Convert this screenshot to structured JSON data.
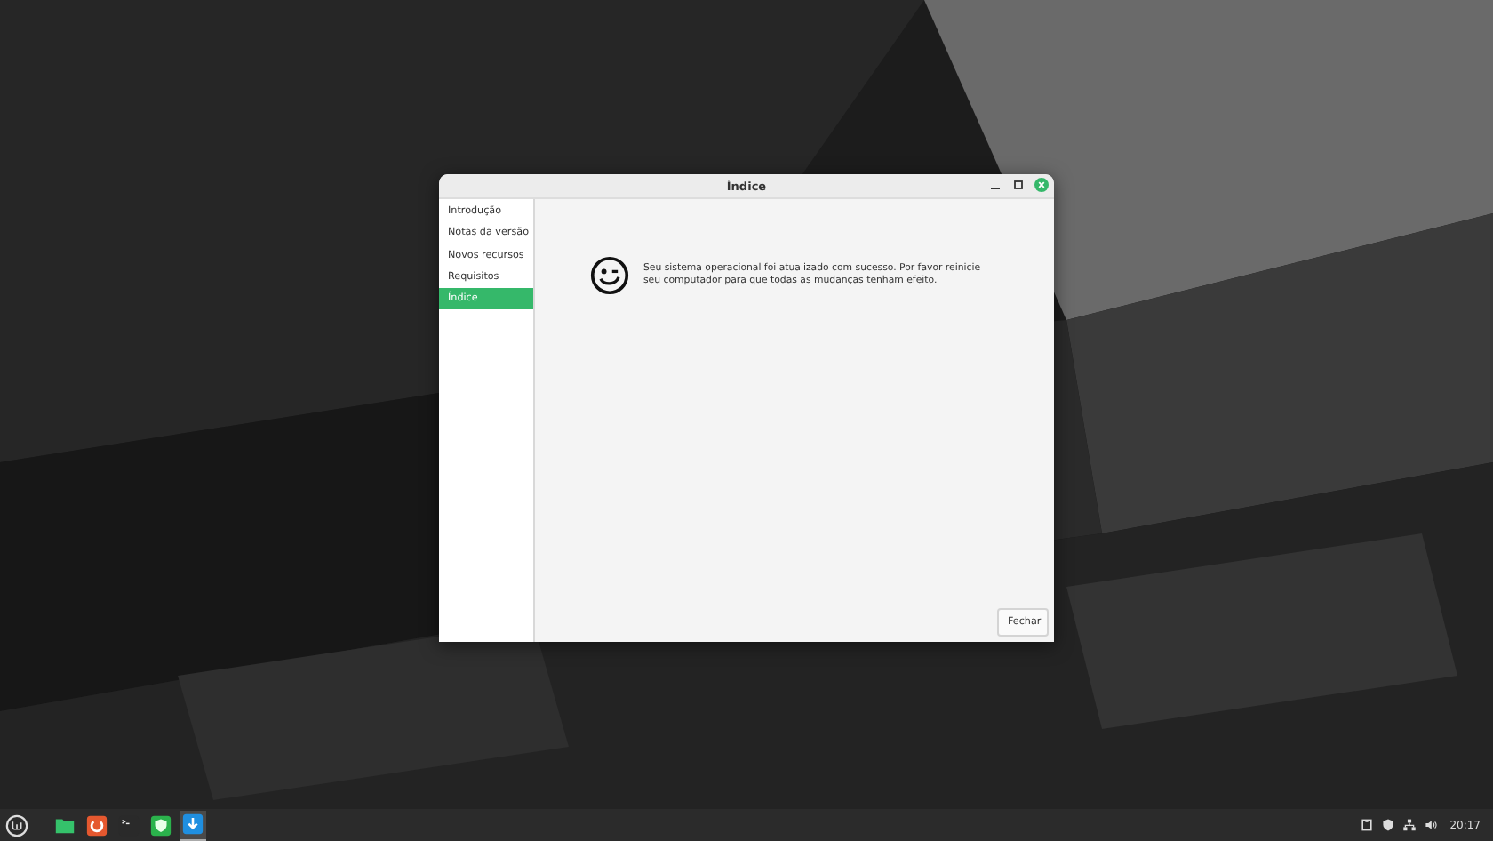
{
  "window": {
    "title": "Índice"
  },
  "sidebar": {
    "items": [
      {
        "label": "Introdução",
        "selected": false
      },
      {
        "label": "Notas da versão",
        "selected": false
      },
      {
        "label": "Novos recursos",
        "selected": false
      },
      {
        "label": "Requisitos",
        "selected": false
      },
      {
        "label": "Índice",
        "selected": true
      }
    ]
  },
  "message": "Seu sistema operacional foi atualizado com sucesso. Por favor reinicie seu computador para que todas as mudanças tenham efeito.",
  "buttons": [
    "Fechar"
  ],
  "taskbar": {
    "apps": [
      {
        "kind": "files",
        "active": false
      },
      {
        "kind": "browser",
        "active": false
      },
      {
        "kind": "terminal",
        "active": false
      },
      {
        "kind": "shield",
        "active": false
      },
      {
        "kind": "download",
        "active": true
      }
    ],
    "clock": "20:17"
  }
}
